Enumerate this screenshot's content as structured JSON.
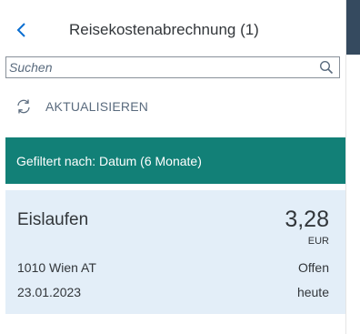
{
  "header": {
    "title": "Reisekostenabrechnung (1)",
    "back_icon": "chevron-left-icon"
  },
  "search": {
    "placeholder": "Suchen",
    "value": "",
    "icon": "search-icon"
  },
  "refresh": {
    "label": "AKTUALISIEREN",
    "icon": "refresh-icon"
  },
  "filter": {
    "text": "Gefiltert nach: Datum (6 Monate)"
  },
  "list": {
    "items": [
      {
        "title": "Eislaufen",
        "amount": "3,28",
        "currency": "EUR",
        "location": "1010 Wien AT",
        "status": "Offen",
        "date": "23.01.2023",
        "relative_date": "heute"
      }
    ]
  },
  "colors": {
    "filter_bar": "#128077",
    "selected_item": "#e3eef8",
    "detail_header": "#354a5f",
    "text": "#32363a",
    "muted_text": "#5a6b7e"
  }
}
